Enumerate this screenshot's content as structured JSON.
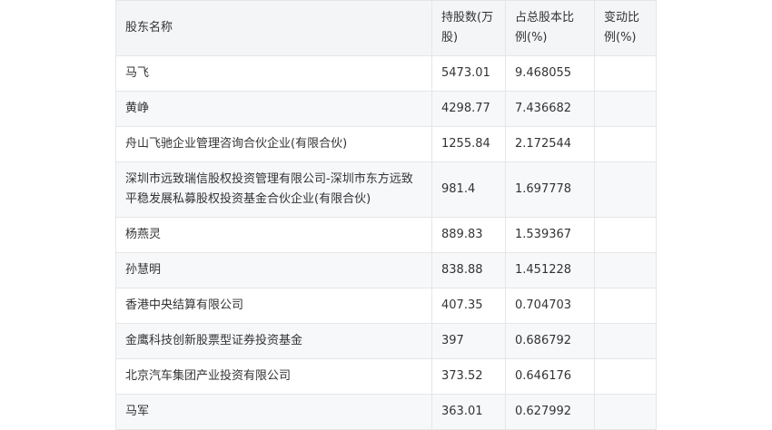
{
  "table": {
    "headers": [
      "股东名称",
      "持股数(万股)",
      "占总股本比例(%)",
      "变动比例(%)"
    ],
    "rows": [
      {
        "name": "马飞",
        "shares": "5473.01",
        "ratio": "9.468055",
        "change": ""
      },
      {
        "name": "黄峥",
        "shares": "4298.77",
        "ratio": "7.436682",
        "change": ""
      },
      {
        "name": "舟山飞驰企业管理咨询合伙企业(有限合伙)",
        "shares": "1255.84",
        "ratio": "2.172544",
        "change": ""
      },
      {
        "name": "深圳市远致瑞信股权投资管理有限公司-深圳市东方远致平稳发展私募股权投资基金合伙企业(有限合伙)",
        "shares": "981.4",
        "ratio": "1.697778",
        "change": ""
      },
      {
        "name": "杨燕灵",
        "shares": "889.83",
        "ratio": "1.539367",
        "change": ""
      },
      {
        "name": "孙慧明",
        "shares": "838.88",
        "ratio": "1.451228",
        "change": ""
      },
      {
        "name": "香港中央结算有限公司",
        "shares": "407.35",
        "ratio": "0.704703",
        "change": ""
      },
      {
        "name": "金鹰科技创新股票型证券投资基金",
        "shares": "397",
        "ratio": "0.686792",
        "change": ""
      },
      {
        "name": "北京汽车集团产业投资有限公司",
        "shares": "373.52",
        "ratio": "0.646176",
        "change": ""
      },
      {
        "name": "马军",
        "shares": "363.01",
        "ratio": "0.627992",
        "change": ""
      }
    ]
  }
}
